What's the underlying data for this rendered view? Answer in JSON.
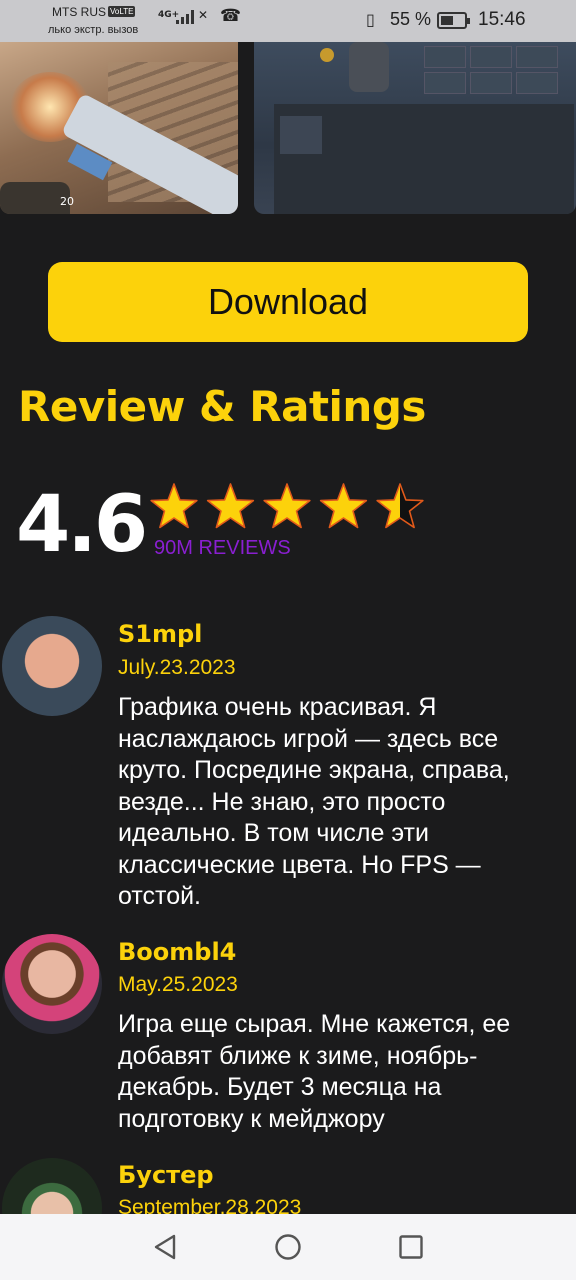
{
  "status_bar": {
    "carrier": "MTS RUS",
    "volte": "VoLTE",
    "sub_text": "лько экстр. вызов",
    "network": "4G+",
    "battery_percent": "55 %",
    "battery_level": 0.55,
    "time": "15:46"
  },
  "screenshots": [
    {
      "icon": "gameplay-screenshot",
      "hud": "20"
    },
    {
      "icon": "inventory-screenshot"
    }
  ],
  "download_label": "Download",
  "section_title": "Review & Ratings",
  "rating": {
    "value": "4.6",
    "stars_filled": 4.5,
    "stars_total": 5,
    "reviews_label": "90M REVIEWS"
  },
  "reviews": [
    {
      "name": "S1mpl",
      "date": "July.23.2023",
      "text": "Графика очень красивая. Я наслаждаюсь игрой — здесь все круто. Посредине экрана, справа, везде... Не знаю, это просто идеально. В том числе эти классические цвета. Но FPS — отстой."
    },
    {
      "name": "Boombl4",
      "date": "May.25.2023",
      "text": "Игра еще сырая. Мне кажется, ее добавят ближе к зиме, ноябрь-декабрь. Будет 3 месяца на подготовку к мейджору"
    },
    {
      "name": "Бустер",
      "date": "September.28.2023",
      "text": ""
    }
  ],
  "colors": {
    "accent": "#fcd20b",
    "background": "#1b1b1c",
    "reviews_count": "#8a1fd1"
  },
  "nav": {
    "back": "back-icon",
    "home": "home-icon",
    "recents": "recents-icon"
  }
}
